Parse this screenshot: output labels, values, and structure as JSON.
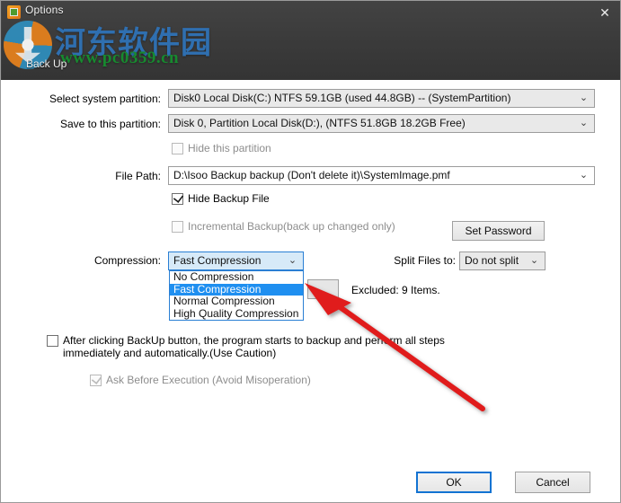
{
  "window": {
    "title": "Options",
    "close_icon": "close-icon",
    "tab_label": "Back Up"
  },
  "watermark": {
    "site_name_cn": "河东软件园",
    "site_url": "www.pc0359.cn"
  },
  "form": {
    "system_partition": {
      "label": "Select system partition:",
      "value": "Disk0  Local Disk(C:) NTFS 59.1GB (used 44.8GB) -- (SystemPartition)"
    },
    "save_partition": {
      "label": "Save to this partition:",
      "value": "Disk 0, Partition Local Disk(D:), (NTFS 51.8GB 18.2GB Free)"
    },
    "hide_partition": {
      "label": "Hide this partition",
      "checked": false,
      "enabled": false
    },
    "file_path": {
      "label": "File Path:",
      "value": "D:\\Isoo Backup backup (Don't delete it)\\SystemImage.pmf"
    },
    "hide_backup_file": {
      "label": "Hide Backup File",
      "checked": true,
      "enabled": true
    },
    "incremental_backup": {
      "label": "Incremental Backup(back up changed only)",
      "checked": false,
      "enabled": false
    },
    "set_password": {
      "label": "Set Password"
    },
    "compression": {
      "label": "Compression:",
      "value": "Fast Compression",
      "expanded": true,
      "options": [
        "No Compression",
        "Fast Compression",
        "Normal Compression",
        "High Quality Compression"
      ],
      "selected_index": 1
    },
    "split_files": {
      "label": "Split Files to:",
      "value": "Do not split"
    },
    "exclude": {
      "button_label": "",
      "status": "Excluded: 9 Items."
    },
    "auto_backup": {
      "label": "After clicking BackUp button, the program starts to backup and perform all steps immediately and automatically.(Use Caution)",
      "checked": false,
      "enabled": true
    },
    "ask_before_execution": {
      "label": "Ask Before Execution (Avoid Misoperation)",
      "checked": true,
      "enabled": false
    }
  },
  "footer": {
    "ok_label": "OK",
    "cancel_label": "Cancel"
  },
  "colors": {
    "header_bg": "#3a3a3a",
    "highlight": "#1f8ff0",
    "accent_border": "#1273d2",
    "annotation": "#e01b1b",
    "watermark_blue": "#2f6fb0",
    "watermark_green": "#178a2f"
  },
  "icons": {
    "chevron": "⌄"
  }
}
